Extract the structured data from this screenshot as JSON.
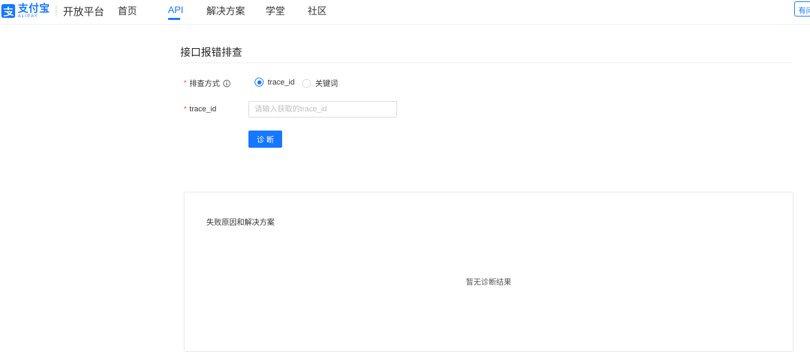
{
  "header": {
    "logo_cn": "支付宝",
    "logo_en": "ALIPAY",
    "platform": "开放平台",
    "nav": [
      {
        "label": "首页",
        "active": false
      },
      {
        "label": "API",
        "active": true
      },
      {
        "label": "解决方案",
        "active": false
      },
      {
        "label": "学堂",
        "active": false
      },
      {
        "label": "社区",
        "active": false
      }
    ],
    "right_button": "有问"
  },
  "page": {
    "title": "接口报错排查",
    "form": {
      "method_label": "排查方式",
      "required_mark": "*",
      "options": [
        {
          "label": "trace_id",
          "checked": true
        },
        {
          "label": "关键词",
          "checked": false
        }
      ],
      "trace_label": "trace_id",
      "trace_placeholder": "请输入获取的trace_id",
      "trace_value": "",
      "submit_label": "诊断"
    },
    "result": {
      "title": "失败原因和解决方案",
      "empty_text": "暂无诊断结果"
    }
  },
  "colors": {
    "accent": "#1677ff",
    "required": "#ff4d4f"
  }
}
